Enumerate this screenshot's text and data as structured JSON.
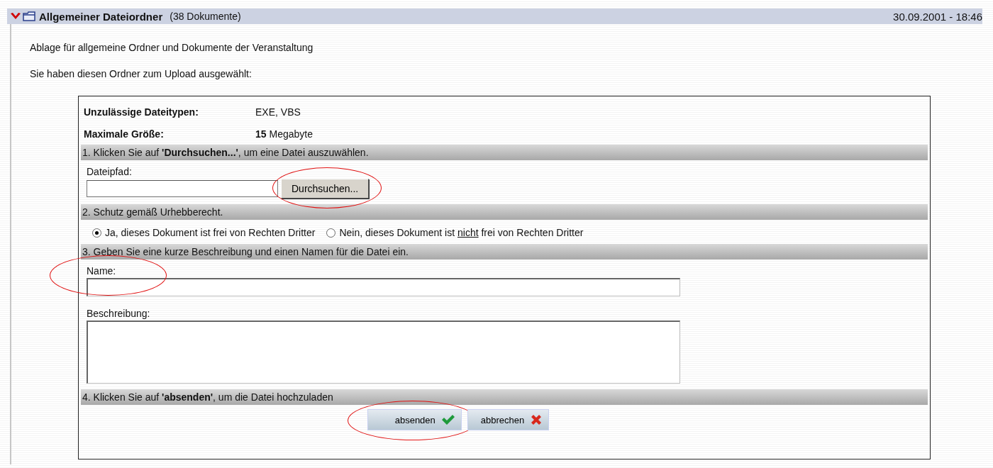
{
  "folder": {
    "title": "Allgemeiner Dateiordner",
    "count": "(38 Dokumente)",
    "date": "30.09.2001 - 18:46",
    "expanded": true
  },
  "description": "Ablage für allgemeine Ordner und Dokumente der Veranstaltung",
  "upload_note": "Sie haben diesen Ordner zum Upload ausgewählt:",
  "upload_form": {
    "info": [
      {
        "label": "Unzulässige Dateitypen:",
        "value": "EXE, VBS"
      },
      {
        "label": "Maximale Größe:",
        "value": "**15** Megabyte"
      }
    ],
    "steps": [
      {
        "kind": "file",
        "heading": "1. Klicken Sie auf **'Durchsuchen...'**, um eine Datei auszuwählen.",
        "field_label": "Dateipfad:",
        "button": "Durchsuchen..."
      },
      {
        "kind": "radio",
        "heading": "2. Schutz gemäß Urhebberecht.",
        "options": [
          {
            "parts": [
              {
                "text": "Ja, dieses Dokument ist frei von Rechten Dritter",
                "underline": false
              }
            ],
            "selected": true
          },
          {
            "parts": [
              {
                "text": "Nein, dieses Dokument ist ",
                "underline": false
              },
              {
                "text": "nicht",
                "underline": true
              },
              {
                "text": " frei von Rechten Dritter",
                "underline": false
              }
            ],
            "selected": false
          }
        ]
      },
      {
        "kind": "text",
        "heading": "3. Geben Sie eine kurze Beschreibung und einen Namen für die Datei ein.",
        "name_label": "Name:",
        "description_label": "Beschreibung:"
      },
      {
        "kind": "submit",
        "heading": "4. Klicken Sie auf **'absenden'**, um die Datei hochzuladen",
        "buttons": [
          {
            "label": "absenden",
            "kind": "confirm"
          },
          {
            "label": "abbrechen",
            "kind": "cancel"
          }
        ]
      }
    ]
  }
}
